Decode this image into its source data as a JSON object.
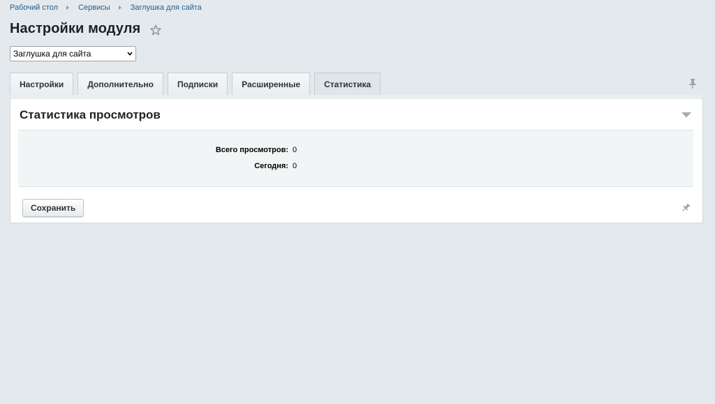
{
  "breadcrumb": {
    "items": [
      {
        "label": "Рабочий стол"
      },
      {
        "label": "Сервисы"
      },
      {
        "label": "Заглушка для сайта"
      }
    ]
  },
  "header": {
    "title": "Настройки модуля",
    "star_icon": "star-outline-icon"
  },
  "site_select": {
    "selected": "Заглушка для сайта"
  },
  "tabs": [
    {
      "label": "Настройки"
    },
    {
      "label": "Дополнительно"
    },
    {
      "label": "Подписки"
    },
    {
      "label": "Расширенные"
    },
    {
      "label": "Статистика",
      "active": true
    }
  ],
  "panel": {
    "title": "Статистика просмотров",
    "stats": [
      {
        "label": "Всего просмотров:",
        "value": "0"
      },
      {
        "label": "Сегодня:",
        "value": "0"
      }
    ],
    "save_label": "Сохранить"
  },
  "colors": {
    "background": "#e3e9ec",
    "link": "#2b5c8a",
    "panel": "#ffffff"
  }
}
